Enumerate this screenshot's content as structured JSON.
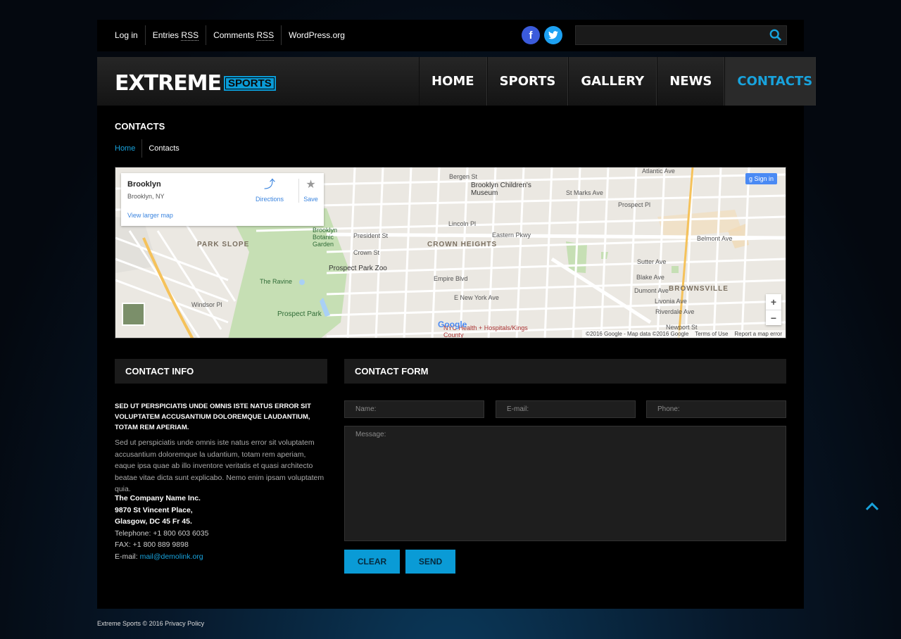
{
  "toplinks": [
    "Log in",
    "Entries",
    "RSS",
    "Comments",
    "RSS",
    "WordPress.org"
  ],
  "social": {
    "facebook": "f",
    "twitter": "t"
  },
  "search": {
    "placeholder": ""
  },
  "logo": {
    "main": "EXTREME",
    "badge": "SPORTS"
  },
  "nav": [
    "HOME",
    "SPORTS",
    "GALLERY",
    "NEWS",
    "CONTACTS"
  ],
  "page": {
    "title": "CONTACTS"
  },
  "breadcrumb": {
    "home": "Home",
    "current": "Contacts"
  },
  "map": {
    "place_title": "Brooklyn",
    "place_sub": "Brooklyn, NY",
    "view_larger": "View larger map",
    "directions": "Directions",
    "save": "Save",
    "sign_in": "Sign in",
    "google": "Google",
    "attribution": [
      "©2016 Google - Map data ©2016 Google",
      "Terms of Use",
      "Report a map error"
    ],
    "labels": {
      "park_slope": "PARK SLOPE",
      "crown_heights": "CROWN HEIGHTS",
      "brownsville": "BROWNSVILLE",
      "childrens_museum": "Brooklyn Children's Museum",
      "botanic": "Brooklyn Botanic Garden",
      "zoo": "Prospect Park Zoo",
      "ravine": "The Ravine",
      "prospect_park": "Prospect Park",
      "nyc_health": "NYC Health + Hospitals/Kings County",
      "eastern_pkwy": "Eastern Pkwy",
      "empire_blvd": "Empire Blvd",
      "atlantic_ave": "Atlantic Ave",
      "lincoln_pl": "Lincoln Pl",
      "sutter_ave": "Sutter Ave",
      "blake_ave": "Blake Ave",
      "dumont_ave": "Dumont Ave",
      "livonia_ave": "Livonia Ave",
      "riverdale_ave": "Riverdale Ave",
      "newport_st": "Newport St",
      "belmont_ave": "Belmont Ave",
      "prospect_pl": "Prospect Pl",
      "st_marks": "St Marks Ave",
      "bergen_st": "Bergen St",
      "president_st": "President St",
      "crown_st": "Crown St",
      "e_new_york": "E New York Ave",
      "windsor_pl": "Windsor Pl"
    }
  },
  "contact_info": {
    "heading": "CONTACT INFO",
    "lead": "SED UT PERSPICIATIS UNDE OMNIS ISTE NATUS ERROR SIT VOLUPTATEM ACCUSANTIUM DOLOREMQUE LAUDANTIUM, TOTAM REM APERIAM.",
    "body": "Sed ut perspiciatis unde omnis iste natus error sit voluptatem accusantium doloremque la udantium, totam rem aperiam, eaque ipsa quae ab illo inventore veritatis et quasi architecto beatae vitae dicta sunt explicabo. Nemo enim ipsam voluptatem quia.",
    "company": "The Company Name Inc.",
    "street": "9870 St Vincent Place,",
    "city": "Glasgow, DC 45 Fr 45.",
    "telephone": "Telephone: +1 800 603 6035",
    "fax": "FAX: +1 800 889 9898",
    "email_label": "E-mail:",
    "email": "mail@demolink.org"
  },
  "contact_form": {
    "heading": "CONTACT FORM",
    "name_placeholder": "Name:",
    "email_placeholder": "E-mail:",
    "phone_placeholder": "Phone:",
    "message_placeholder": "Message:",
    "clear": "CLEAR",
    "send": "SEND"
  },
  "footer": {
    "text": "Extreme Sports © 2016 Privacy Policy"
  },
  "colors": {
    "accent": "#0a9bd6",
    "panel": "#000000",
    "header": "#1c1c1c"
  }
}
